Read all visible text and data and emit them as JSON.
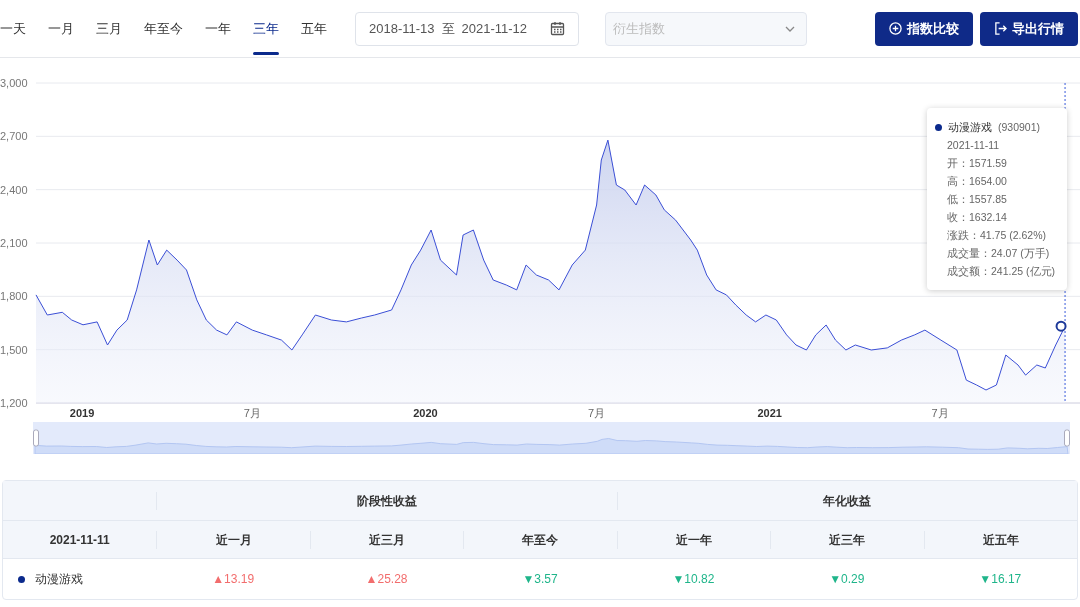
{
  "period_tabs": [
    {
      "label": "一天",
      "selected": false
    },
    {
      "label": "一月",
      "selected": false
    },
    {
      "label": "三月",
      "selected": false
    },
    {
      "label": "年至今",
      "selected": false
    },
    {
      "label": "一年",
      "selected": false
    },
    {
      "label": "三年",
      "selected": true
    },
    {
      "label": "五年",
      "selected": false
    }
  ],
  "date_range": {
    "start": "2018-11-13",
    "separator": "至",
    "end": "2021-11-12"
  },
  "derived_index_dropdown": {
    "placeholder": "衍生指数",
    "disabled": true
  },
  "buttons": [
    {
      "kind": "compare",
      "label": "指数比较"
    },
    {
      "kind": "export",
      "label": "导出行情"
    }
  ],
  "chart": {
    "chart_data": {
      "type": "area",
      "grid": true,
      "ylim": [
        1200,
        3000
      ],
      "xlim": [
        "2018-11-13",
        "2021-11-12"
      ],
      "yticks": [
        {
          "value": 1200,
          "label": "1,200"
        },
        {
          "value": 1500,
          "label": "1,500"
        },
        {
          "value": 1800,
          "label": "1,800"
        },
        {
          "value": 2100,
          "label": "2,100"
        },
        {
          "value": 2400,
          "label": "2,400"
        },
        {
          "value": 2700,
          "label": "2,700"
        },
        {
          "value": 3000,
          "label": "3,000"
        }
      ],
      "xticks": [
        {
          "value": "2019-01-01",
          "label": "2019"
        },
        {
          "value": "2019-07-01",
          "label": "7月"
        },
        {
          "value": "2020-01-01",
          "label": "2020"
        },
        {
          "value": "2020-07-01",
          "label": "7月"
        },
        {
          "value": "2021-01-01",
          "label": "2021"
        },
        {
          "value": "2021-07-01",
          "label": "7月"
        }
      ],
      "x": [
        "2018-11-13",
        "2018-11-25",
        "2018-12-11",
        "2018-12-21",
        "2019-01-02",
        "2019-01-17",
        "2019-01-28",
        "2019-02-07",
        "2019-02-18",
        "2019-02-28",
        "2019-03-13",
        "2019-03-22",
        "2019-04-01",
        "2019-04-12",
        "2019-04-22",
        "2019-05-03",
        "2019-05-13",
        "2019-05-24",
        "2019-06-04",
        "2019-06-14",
        "2019-07-01",
        "2019-07-16",
        "2019-08-01",
        "2019-08-12",
        "2019-08-23",
        "2019-09-06",
        "2019-09-23",
        "2019-10-09",
        "2019-10-25",
        "2019-11-08",
        "2019-11-26",
        "2019-12-06",
        "2019-12-17",
        "2019-12-27",
        "2020-01-07",
        "2020-01-17",
        "2020-02-03",
        "2020-02-10",
        "2020-02-21",
        "2020-03-03",
        "2020-03-13",
        "2020-03-27",
        "2020-04-07",
        "2020-04-17",
        "2020-04-28",
        "2020-05-11",
        "2020-05-22",
        "2020-06-05",
        "2020-06-19",
        "2020-07-01",
        "2020-07-06",
        "2020-07-13",
        "2020-07-22",
        "2020-07-31",
        "2020-08-12",
        "2020-08-21",
        "2020-09-02",
        "2020-09-11",
        "2020-09-23",
        "2020-10-09",
        "2020-10-16",
        "2020-10-26",
        "2020-11-05",
        "2020-11-16",
        "2020-11-26",
        "2020-12-07",
        "2020-12-17",
        "2020-12-28",
        "2021-01-08",
        "2021-01-19",
        "2021-01-29",
        "2021-02-09",
        "2021-02-19",
        "2021-03-02",
        "2021-03-12",
        "2021-03-23",
        "2021-04-02",
        "2021-04-19",
        "2021-05-06",
        "2021-05-21",
        "2021-06-04",
        "2021-06-15",
        "2021-07-02",
        "2021-07-19",
        "2021-07-29",
        "2021-08-09",
        "2021-08-19",
        "2021-08-30",
        "2021-09-09",
        "2021-09-22",
        "2021-09-30",
        "2021-10-12",
        "2021-10-21",
        "2021-11-01",
        "2021-11-11"
      ],
      "series": [
        {
          "name": "动漫游戏",
          "color": "#3b4fd6",
          "values": [
            1808,
            1695,
            1710,
            1667,
            1640,
            1656,
            1526,
            1610,
            1667,
            1836,
            2117,
            1976,
            2060,
            2004,
            1948,
            1780,
            1667,
            1610,
            1583,
            1656,
            1610,
            1583,
            1554,
            1498,
            1583,
            1695,
            1667,
            1656,
            1678,
            1695,
            1723,
            1836,
            1976,
            2060,
            2173,
            2004,
            1920,
            2145,
            2173,
            2004,
            1892,
            1864,
            1836,
            1976,
            1920,
            1892,
            1836,
            1976,
            2060,
            2314,
            2567,
            2679,
            2426,
            2398,
            2314,
            2426,
            2370,
            2286,
            2229,
            2117,
            2060,
            1920,
            1836,
            1808,
            1751,
            1695,
            1656,
            1695,
            1667,
            1583,
            1526,
            1498,
            1583,
            1639,
            1554,
            1498,
            1526,
            1498,
            1510,
            1554,
            1583,
            1610,
            1554,
            1498,
            1329,
            1301,
            1273,
            1301,
            1470,
            1414,
            1357,
            1414,
            1397,
            1526,
            1632
          ]
        }
      ]
    },
    "tooltip": {
      "code": "(930901)",
      "color": "#0b2a8c",
      "lines": [
        "2021-11-11",
        "开：1571.59",
        "高：1654.00",
        "低：1557.85",
        "收：1632.14",
        "涨跌：41.75 (2.62%)",
        "成交量：24.07 (万手)",
        "成交额：241.25 (亿元)"
      ]
    }
  },
  "returns_table": {
    "first_column": "2021-11-11",
    "groups": [
      {
        "label": "阶段性收益",
        "columns": [
          "近一月",
          "近三月",
          "年至今"
        ]
      },
      {
        "label": "年化收益",
        "columns": [
          "近一年",
          "近三年",
          "近五年"
        ]
      }
    ],
    "rows": [
      {
        "name": "动漫游戏",
        "color": "#0b2a8c",
        "cells": [
          {
            "text": "▲13.19",
            "up": true
          },
          {
            "text": "▲25.28",
            "up": true
          },
          {
            "text": "▼3.57",
            "up": false
          },
          {
            "text": "▼10.82",
            "up": false
          },
          {
            "text": "▼0.29",
            "up": false
          },
          {
            "text": "▼16.17",
            "up": false
          }
        ]
      }
    ]
  }
}
